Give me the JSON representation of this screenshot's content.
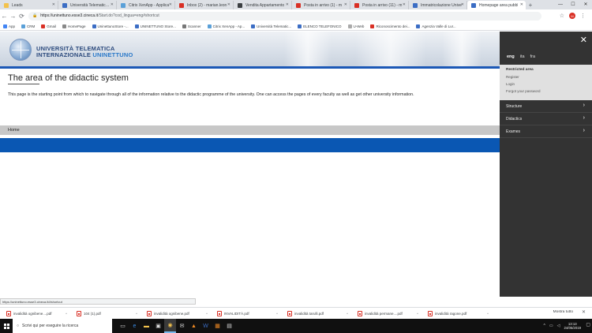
{
  "browser": {
    "tabs": [
      {
        "label": "Leads",
        "color": "#f3c24d",
        "active": false
      },
      {
        "label": "Università Telematica Int",
        "color": "#3b6dc4",
        "active": false
      },
      {
        "label": "Citrix XenApp - Applica",
        "color": "#5aa0d8",
        "active": false
      },
      {
        "label": "Inbox (2) - marian.leon",
        "color": "#d93025",
        "active": false
      },
      {
        "label": "Vendita Appartamento",
        "color": "#3c4043",
        "active": false
      },
      {
        "label": "Posta in arrivo (1) - m",
        "color": "#d93025",
        "active": false
      },
      {
        "label": "Posta in arrivo (11) - m",
        "color": "#d93025",
        "active": false
      },
      {
        "label": "Immatricolazione Unive",
        "color": "#3b6dc4",
        "active": false
      },
      {
        "label": "Homepage area pubbl",
        "color": "#3b6dc4",
        "active": true
      }
    ],
    "new_tab": "+",
    "window_controls": {
      "minimize": "—",
      "maximize": "☐",
      "close": "✕"
    },
    "address": {
      "host": "https://uninettuno.esse3.cineca.it",
      "path": "/Start.do?cod_lingua=eng#shortcut"
    },
    "avatar_initials": "M",
    "bookmarks": [
      {
        "label": "App",
        "color": "#4285f4"
      },
      {
        "label": "CRM",
        "color": "#5aa0d8"
      },
      {
        "label": "Gmail",
        "color": "#d93025"
      },
      {
        "label": "HomePage",
        "color": "#888888"
      },
      {
        "label": "UninettunoStore -...",
        "color": "#3b6dc4"
      },
      {
        "label": "UNINETTUNO Store...",
        "color": "#3b6dc4"
      },
      {
        "label": "Scanner",
        "color": "#777777"
      },
      {
        "label": "Citrix XenApp - Ap...",
        "color": "#5aa0d8"
      },
      {
        "label": "Università Telematic...",
        "color": "#3b6dc4"
      },
      {
        "label": "ELENCO TELEFONICO",
        "color": "#3b6dc4"
      },
      {
        "label": "U-Web",
        "color": "#aaaaaa"
      },
      {
        "label": "Riconoscimento dei...",
        "color": "#d93025"
      },
      {
        "label": "Agenzia Valle di Lur...",
        "color": "#3b6dc4"
      }
    ],
    "status_url": "https://uninettuno.esse3.cineca.it/#shortcut"
  },
  "page": {
    "logo_line1": "UNIVERSITÀ TELEMATICA",
    "logo_line2a": "INTERNAZIONALE ",
    "logo_line2b": "UNINETTUNO",
    "title": "The area of the didactic system",
    "intro": "This page is the starting point from which to navigate through all of the information relative to the didactic programme of the university. One can access the pages of every faculty as well as get other university information.",
    "breadcrumb": "Home"
  },
  "sidemenu": {
    "close": "✕",
    "languages": [
      "eng",
      "ita",
      "fra"
    ],
    "restricted_title": "Restricted area",
    "register": "Register",
    "login": "Login",
    "forgot": "Forgot your password",
    "items": [
      "Structure",
      "Didactics",
      "Exames"
    ]
  },
  "downloads": {
    "files": [
      "invalidità ognibene....pdf",
      "104 (1).pdf",
      "invalidità ognibene.pdf",
      "INVALIDITÀ.pdf",
      "invalidità tarulli.pdf",
      "invalidità permane....pdf",
      "invalidità ragone.pdf"
    ],
    "show_all": "Mostra tutto",
    "close": "✕"
  },
  "taskbar": {
    "search_placeholder": "Scrivi qui per eseguire la ricerca",
    "time": "13:13",
    "date": "24/05/2019"
  }
}
